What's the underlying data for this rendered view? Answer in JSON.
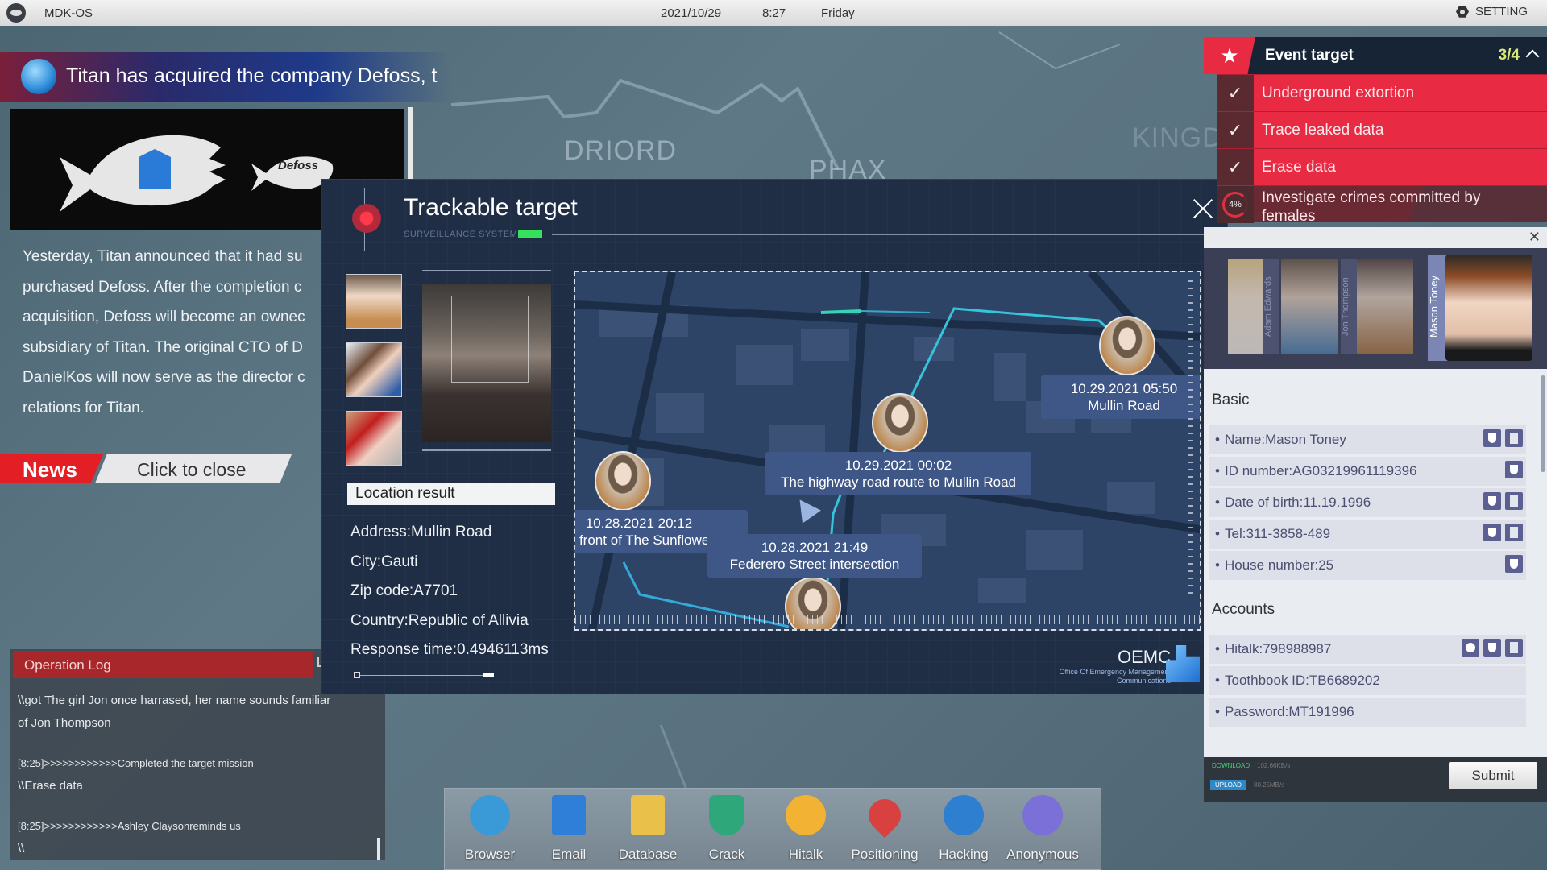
{
  "topbar": {
    "os_name": "MDK-OS",
    "date": "2021/10/29",
    "time": "8:27",
    "day": "Friday",
    "setting_label": "SETTING"
  },
  "background_map": {
    "regions": [
      "DRIORD",
      "PHAX",
      "KINGDO"
    ]
  },
  "news": {
    "headline": "Titan has acquired the company Defoss, t",
    "image_caption": "Defoss",
    "body_lines": [
      "Yesterday, Titan announced that it had su",
      "purchased Defoss. After the completion c",
      "acquisition, Defoss will become an ownec",
      "subsidiary of Titan. The original CTO of D",
      "DanielKos will now serve as the director c",
      "relations for Titan."
    ],
    "tag_label": "News",
    "close_label": "Click to close"
  },
  "operation_log": {
    "title": "Operation Log",
    "entries": [
      {
        "text": "\\\\got The girl Jon once harrased, her name sounds familiar of Jon Thompson",
        "style": "l1"
      },
      {
        "text": "[8:25]>>>>>>>>>>>>Completed the target mission",
        "style": "l2"
      },
      {
        "text": "\\\\Erase data",
        "style": "l1"
      },
      {
        "text": "[8:25]>>>>>>>>>>>>Ashley Claysonreminds us",
        "style": "l2"
      },
      {
        "text": "\\\\",
        "style": "l1"
      }
    ]
  },
  "tracker": {
    "title": "Trackable target",
    "subtitle": "SURVEILLANCE SYSTEM",
    "location_header": "Location result",
    "location": [
      "Address:Mullin Road",
      "City:Gauti",
      "Zip code:A7701",
      "Country:Republic of Allivia",
      "Response time:0.4946113ms"
    ],
    "map_points": [
      {
        "time": "10.28.2021 20:12",
        "place": "In front of The Sunflower"
      },
      {
        "time": "10.28.2021 21:49",
        "place": "Federero Street intersection"
      },
      {
        "time": "10.29.2021 00:02",
        "place": "The highway road route to Mullin Road"
      },
      {
        "time": "10.29.2021 05:50",
        "place": "Mullin Road"
      }
    ],
    "org_short": "OEMC",
    "org_line1": "Office Of Emergency Management",
    "org_line2": "Communications"
  },
  "event_target": {
    "title": "Event target",
    "progress": "3/4",
    "items": [
      {
        "label": "Underground extortion",
        "done": true
      },
      {
        "label": "Trace leaked data",
        "done": true
      },
      {
        "label": "Erase data",
        "done": true
      },
      {
        "label": "Investigate crimes committed by females",
        "done": false,
        "percent": "4%"
      }
    ]
  },
  "profile": {
    "portrait_names": [
      "Adam Edwards",
      "Jon Thompson",
      "Mason Toney"
    ],
    "basic_title": "Basic",
    "basic_fields": [
      {
        "text": "Name:Mason Toney",
        "icons": [
          "shield",
          "doc"
        ]
      },
      {
        "text": "ID number:AG03219961119396",
        "icons": [
          "shield"
        ]
      },
      {
        "text": "Date of birth:11.19.1996",
        "icons": [
          "shield",
          "doc"
        ]
      },
      {
        "text": "Tel:311-3858-489",
        "icons": [
          "shield",
          "doc"
        ]
      },
      {
        "text": "House number:25",
        "icons": [
          "shield"
        ]
      }
    ],
    "accounts_title": "Accounts",
    "account_fields": [
      {
        "text": "Hitalk:798988987",
        "icons": [
          "phone",
          "shield",
          "doc"
        ]
      },
      {
        "text": "Toothbook ID:TB6689202",
        "icons": []
      },
      {
        "text": "Password:MT191996",
        "icons": []
      }
    ],
    "download_label": "DOWNLOAD",
    "download_rate": "102.66KB/s",
    "upload_label": "UPLOAD",
    "upload_rate": "80.25MB/s",
    "submit_label": "Submit"
  },
  "dock": {
    "apps": [
      {
        "name": "Browser",
        "color": "#3a9ad8"
      },
      {
        "name": "Email",
        "color": "#2f7fd8"
      },
      {
        "name": "Database",
        "color": "#e8c04a"
      },
      {
        "name": "Crack",
        "color": "#2ea87a"
      },
      {
        "name": "Hitalk",
        "color": "#f2b233"
      },
      {
        "name": "Positioning",
        "color": "#d94040"
      },
      {
        "name": "Hacking",
        "color": "#2e7fd0"
      },
      {
        "name": "Anonymous",
        "color": "#7b6fd8"
      }
    ]
  }
}
